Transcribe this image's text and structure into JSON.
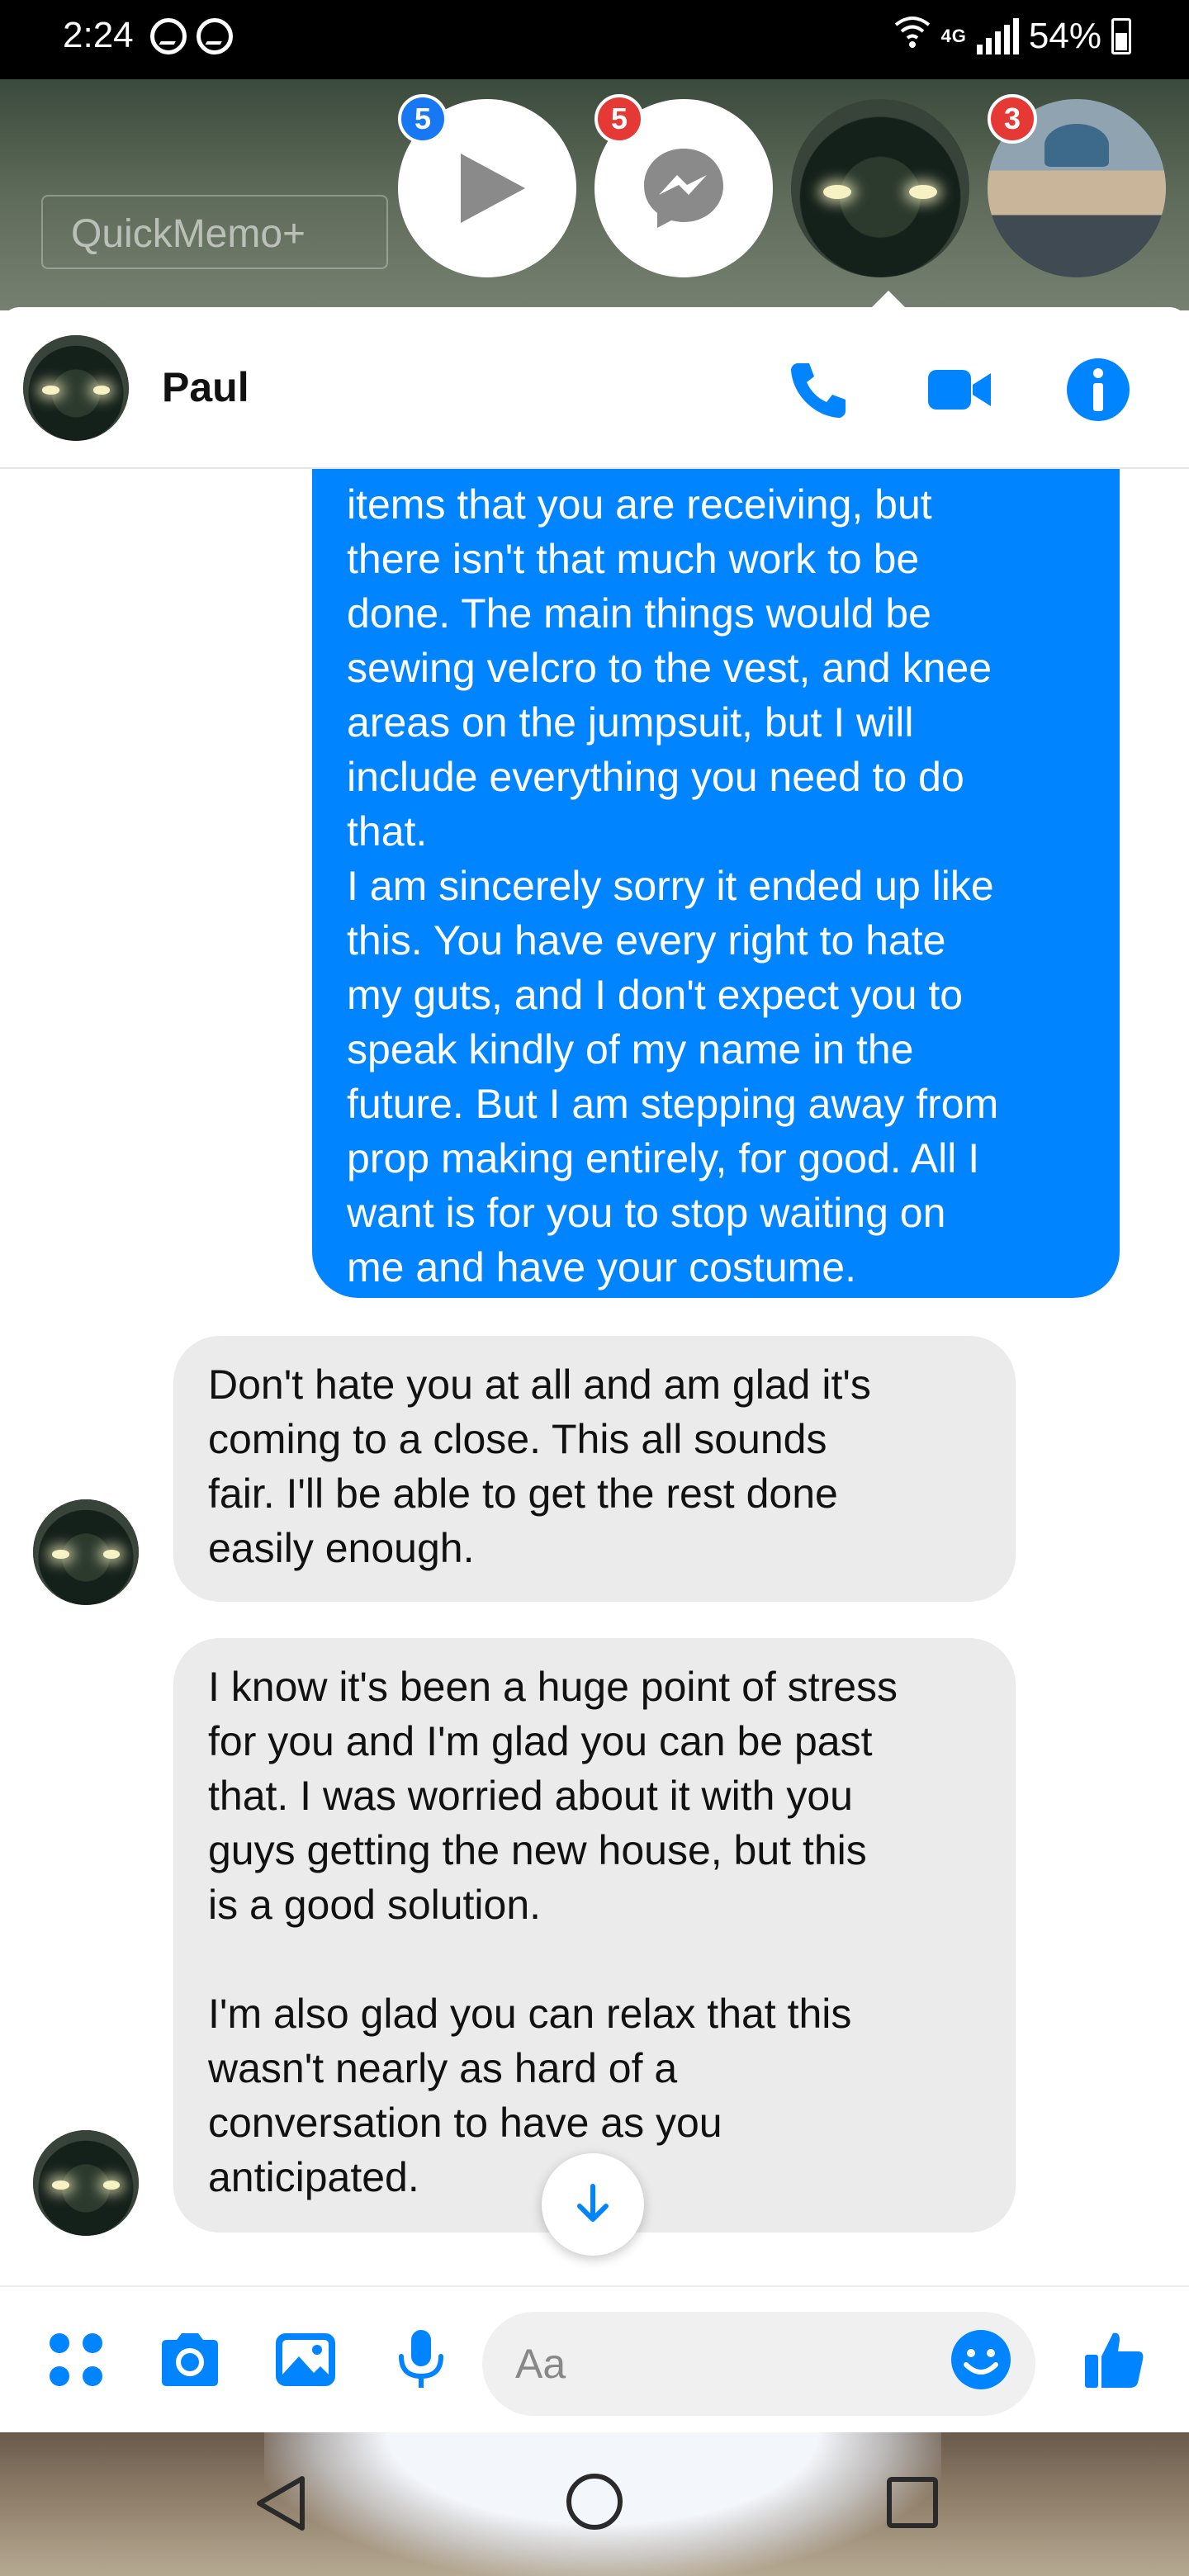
{
  "status_bar": {
    "time": "2:24",
    "network": "4G",
    "battery_percent": "54%"
  },
  "overlay": {
    "background_app_label": "QuickMemo+",
    "chat_heads": [
      {
        "type": "play",
        "badge": "5",
        "badge_color": "#1877f2"
      },
      {
        "type": "messenger",
        "badge": "5",
        "badge_color": "#e53935"
      },
      {
        "type": "car-photo",
        "badge": null
      },
      {
        "type": "person-photo",
        "badge": "3",
        "badge_color": "#e53935"
      }
    ]
  },
  "header": {
    "contact_name": "Paul",
    "accent": "#0084ff"
  },
  "messages": [
    {
      "direction": "outgoing",
      "text": "items that you are receiving, but\nthere isn't that much work to be\ndone. The main things would be\nsewing velcro to the vest, and knee\nareas on the jumpsuit, but I will\ninclude everything you need to do\nthat.\nI am sincerely sorry it ended up like\nthis. You have every right to hate\nmy guts, and I don't expect you to\nspeak kindly of my name in the\nfuture. But I am stepping away from\nprop making entirely, for good. All I\nwant is for you to stop waiting on\nme and have your costume."
    },
    {
      "direction": "incoming",
      "text": "Don't hate you at all and am glad it's\ncoming to a close. This all sounds\nfair. I'll be able to get the rest done\neasily enough."
    },
    {
      "direction": "incoming",
      "text": "I know it's been a huge point of stress\nfor you and I'm glad you can be past\nthat. I was worried about it with you\nguys getting the new house, but this\nis a good solution.\n\nI'm also glad you can relax that this\nwasn't nearly as hard of a\nconversation to have as you\nanticipated."
    }
  ],
  "composer": {
    "placeholder": "Aa",
    "icons": [
      "more-icon",
      "camera-icon",
      "gallery-icon",
      "microphone-icon",
      "emoji-icon",
      "thumbs-up-icon"
    ]
  },
  "colors": {
    "outgoing_bubble": "#0084ff",
    "incoming_bubble": "#ebebeb",
    "icon_blue": "#0084ff"
  }
}
